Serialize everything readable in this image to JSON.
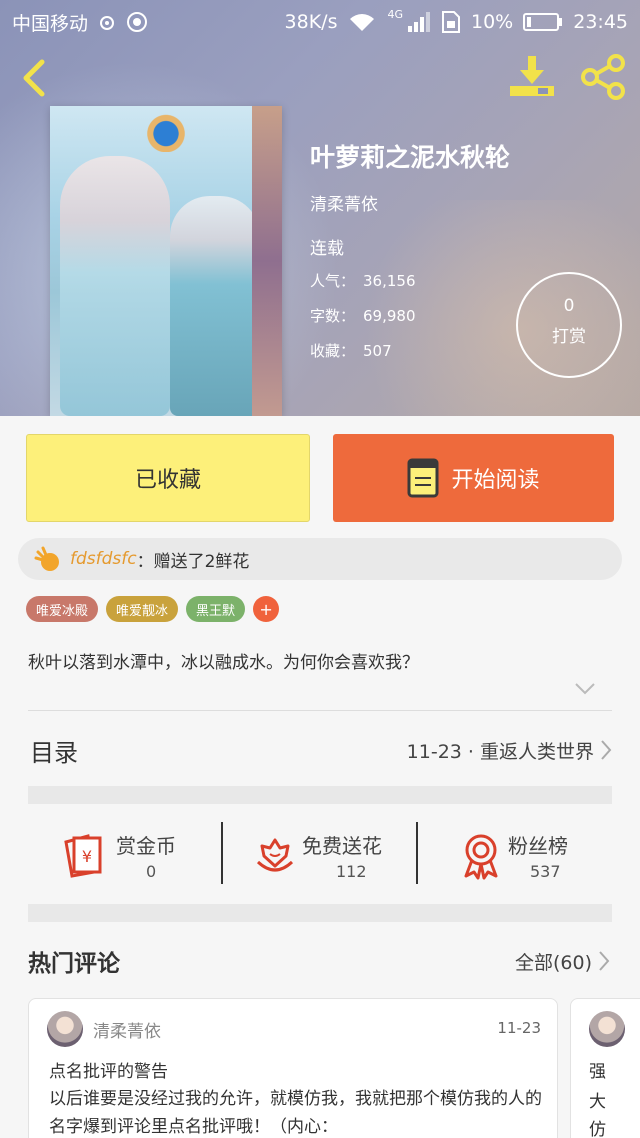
{
  "status_bar": {
    "carrier": "中国移动",
    "speed": "38K/s",
    "network": "4G",
    "battery": "10%",
    "time": "23:45"
  },
  "book": {
    "title": "叶萝莉之泥水秋轮",
    "author": "清柔菁依",
    "status": "连载",
    "popularity_label": "人气：",
    "popularity": "36,156",
    "words_label": "字数：",
    "words": "69,980",
    "favorites_label": "收藏：",
    "favorites": "507"
  },
  "tip": {
    "count": "0",
    "label": "打赏"
  },
  "actions": {
    "collected_label": "已收藏",
    "read_label": "开始阅读"
  },
  "gift": {
    "user": "fdsfdsfc",
    "text": "：赠送了2鲜花"
  },
  "tags": [
    {
      "label": "唯爱冰殿",
      "color": "#c8786a"
    },
    {
      "label": "唯爱靓冰",
      "color": "#c9a23c"
    },
    {
      "label": "黑王默",
      "color": "#7cb26a"
    }
  ],
  "tag_add": "+",
  "description": "秋叶以落到水潭中，冰以融成水。为何你会喜欢我？",
  "catalog": {
    "title": "目录",
    "latest": "11-23 · 重返人类世界"
  },
  "stats": {
    "coins": {
      "label": "赏金币",
      "value": "0"
    },
    "flowers": {
      "label": "免费送花",
      "value": "112"
    },
    "fans": {
      "label": "粉丝榜",
      "value": "537"
    }
  },
  "comments": {
    "title": "热门评论",
    "all_label": "全部(60)",
    "items": [
      {
        "name": "清柔菁依",
        "date": "11-23",
        "heading": "点名批评的警告",
        "body": "以后谁要是没经过我的允许，就模仿我，我就把那个模仿我的人的名字爆到评论里点名批评哦！（内心："
      }
    ],
    "peek_lines": [
      "强",
      "大",
      "仿"
    ]
  },
  "colors": {
    "accent_orange": "#ee6a3c",
    "collected_yellow": "#fdf07a",
    "icon_red": "#d9402b"
  }
}
